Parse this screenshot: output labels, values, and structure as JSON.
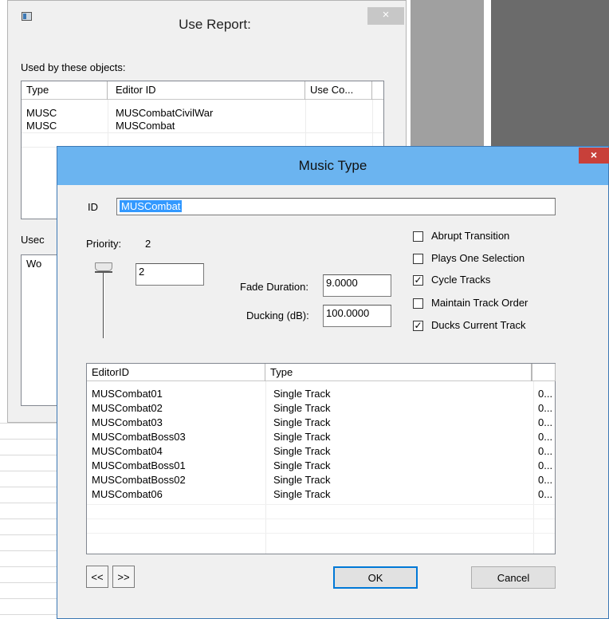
{
  "use_report": {
    "title": "Use Report:",
    "close_glyph": "×",
    "used_by_label": "Used by these objects:",
    "columns": [
      "Type",
      "Editor ID",
      "Use Co..."
    ],
    "rows": [
      {
        "type": "MUSC",
        "editor_id": "MUSCombatCivilWar"
      },
      {
        "type": "MUSC",
        "editor_id": "MUSCombat"
      }
    ],
    "second_label": "Usec",
    "second_column": "Wo"
  },
  "music_type": {
    "title": "Music Type",
    "close_glyph": "×",
    "id_label": "ID",
    "id_value": "MUSCombat",
    "priority_label": "Priority:",
    "priority_value": "2",
    "priority_field": "2",
    "fade_label": "Fade Duration:",
    "fade_value": "9.0000",
    "ducking_label": "Ducking (dB):",
    "ducking_value": "100.0000",
    "checkboxes": [
      {
        "label": "Abrupt Transition",
        "checked": false
      },
      {
        "label": "Plays One Selection",
        "checked": false
      },
      {
        "label": "Cycle Tracks",
        "checked": true
      },
      {
        "label": "Maintain Track Order",
        "checked": false
      },
      {
        "label": "Ducks Current Track",
        "checked": true
      }
    ],
    "check_glyph": "✓",
    "columns": [
      "EditorID",
      "Type",
      ""
    ],
    "tracks": [
      {
        "editor_id": "MUSCombat01",
        "type": "Single Track",
        "extra": "0..."
      },
      {
        "editor_id": "MUSCombat02",
        "type": "Single Track",
        "extra": "0..."
      },
      {
        "editor_id": "MUSCombat03",
        "type": "Single Track",
        "extra": "0..."
      },
      {
        "editor_id": "MUSCombatBoss03",
        "type": "Single Track",
        "extra": "0..."
      },
      {
        "editor_id": "MUSCombat04",
        "type": "Single Track",
        "extra": "0..."
      },
      {
        "editor_id": "MUSCombatBoss01",
        "type": "Single Track",
        "extra": "0..."
      },
      {
        "editor_id": "MUSCombatBoss02",
        "type": "Single Track",
        "extra": "0..."
      },
      {
        "editor_id": "MUSCombat06",
        "type": "Single Track",
        "extra": "0..."
      }
    ],
    "prev_label": "<<",
    "next_label": ">>",
    "ok_label": "OK",
    "cancel_label": "Cancel"
  },
  "colors": {
    "titlebar_active": "#6bb4f0",
    "close_active": "#c8403a",
    "selection": "#3399ff"
  }
}
